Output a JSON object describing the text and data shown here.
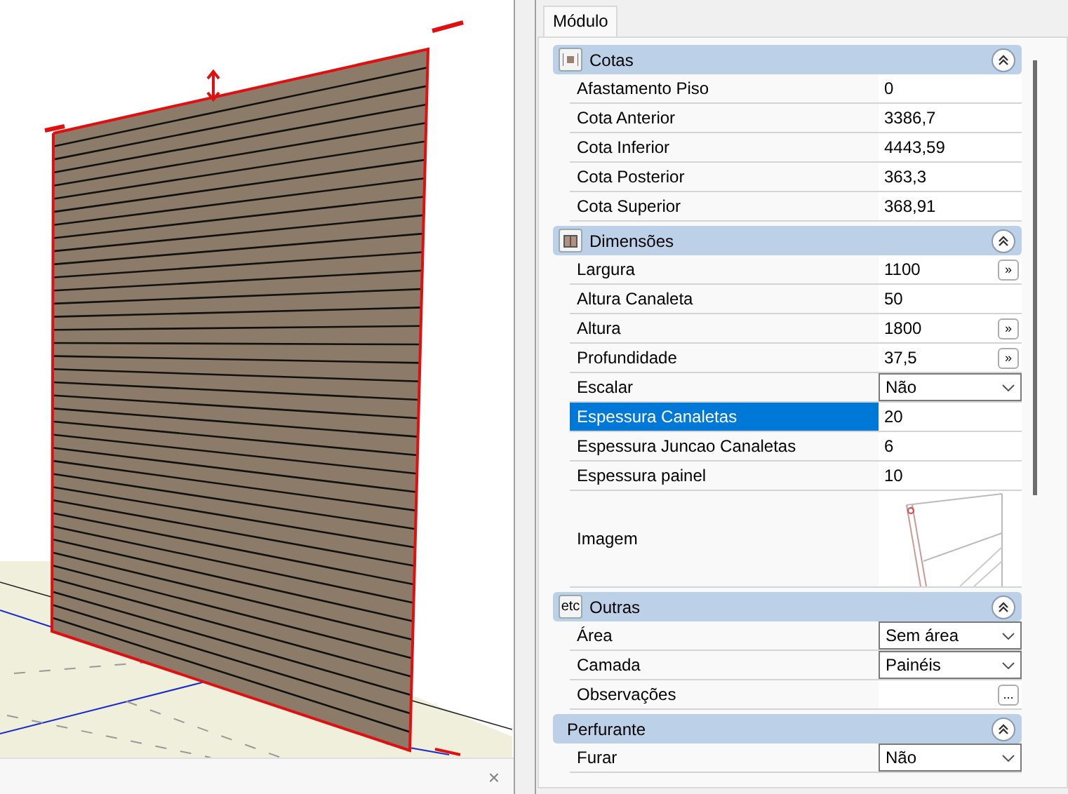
{
  "viewport": {
    "close_label": "×"
  },
  "panel": {
    "tabs": [
      {
        "label": "Módulo",
        "selected": true
      }
    ],
    "sections": [
      {
        "title": "Cotas",
        "kind": "dimension",
        "expanded": true,
        "rows": [
          {
            "kind": "text",
            "label": "Afastamento Piso",
            "value": "0",
            "selected": false
          },
          {
            "kind": "text",
            "label": "Cota Anterior",
            "value": "3386,7",
            "selected": false
          },
          {
            "kind": "text",
            "label": "Cota Inferior",
            "value": "4443,59",
            "selected": false
          },
          {
            "kind": "text",
            "label": "Cota Posterior",
            "value": "363,3",
            "selected": false
          },
          {
            "kind": "text",
            "label": "Cota Superior",
            "value": "368,91",
            "selected": false
          }
        ]
      },
      {
        "title": "Dimensões",
        "kind": "cabinet",
        "expanded": true,
        "rows": [
          {
            "kind": "expand",
            "label": "Largura",
            "value": "1100",
            "button": "»",
            "selected": false
          },
          {
            "kind": "text",
            "label": "Altura Canaleta",
            "value": "50",
            "selected": false
          },
          {
            "kind": "expand",
            "label": "Altura",
            "value": "1800",
            "button": "»",
            "selected": false
          },
          {
            "kind": "expand",
            "label": "Profundidade",
            "value": "37,5",
            "button": "»",
            "selected": false
          },
          {
            "kind": "dropdown",
            "label": "Escalar",
            "value": "Não",
            "selected": false
          },
          {
            "kind": "text",
            "label": "Espessura Canaletas",
            "value": "20",
            "selected": true
          },
          {
            "kind": "text",
            "label": "Espessura Juncao Canaletas",
            "value": "6",
            "selected": false
          },
          {
            "kind": "text",
            "label": "Espessura painel",
            "value": "10",
            "selected": false
          },
          {
            "kind": "image",
            "label": "Imagem",
            "selected": false
          }
        ]
      },
      {
        "title": "Outras",
        "kind": "text",
        "icon_text": "etc",
        "expanded": true,
        "rows": [
          {
            "kind": "dropdown",
            "label": "Área",
            "value": "Sem área",
            "selected": false
          },
          {
            "kind": "dropdown",
            "label": "Camada",
            "value": "Painéis",
            "selected": false
          },
          {
            "kind": "ellipsis",
            "label": "Observações",
            "button": "...",
            "selected": false
          }
        ]
      },
      {
        "title": "Perfurante",
        "kind": "plain",
        "expanded": true,
        "rows": [
          {
            "kind": "dropdown",
            "label": "Furar",
            "value": "Não",
            "selected": false
          }
        ]
      }
    ]
  }
}
